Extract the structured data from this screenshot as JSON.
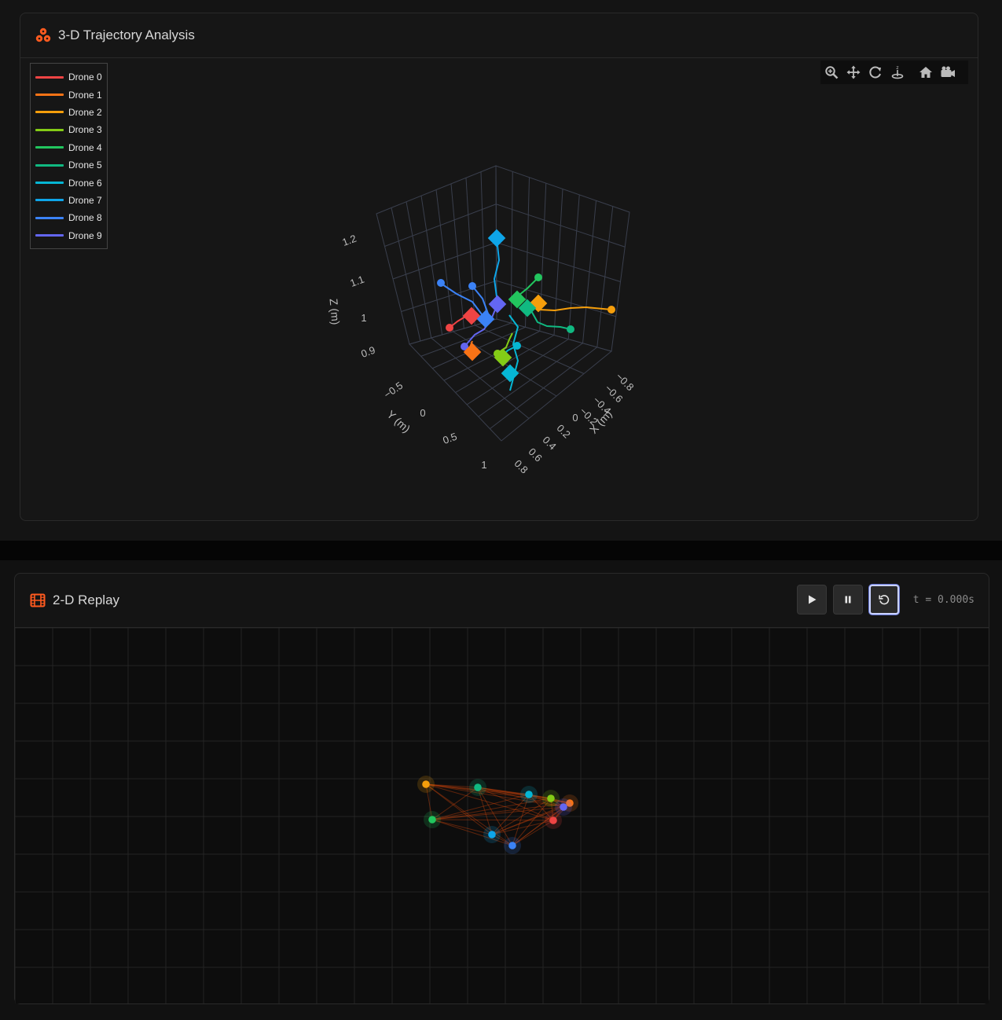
{
  "colors": {
    "accent": "#ff5a1f",
    "drones": [
      "#ef4444",
      "#f97316",
      "#f59e0b",
      "#84cc16",
      "#22c55e",
      "#10b981",
      "#06b6d4",
      "#0ea5e9",
      "#3b82f6",
      "#6366f1"
    ]
  },
  "panel3d": {
    "title": "3-D Trajectory Analysis",
    "icon": "drone-cluster-icon",
    "modebar": [
      "zoom-icon",
      "pan-icon",
      "orbit-rotate-icon",
      "turntable-rotate-icon",
      "reset-camera-home-icon",
      "camera-snapshot-icon"
    ],
    "legend": [
      "Drone 0",
      "Drone 1",
      "Drone 2",
      "Drone 3",
      "Drone 4",
      "Drone 5",
      "Drone 6",
      "Drone 7",
      "Drone 8",
      "Drone 9"
    ],
    "axes": {
      "x": {
        "title": "X (m)",
        "ticks": [
          "−0.8",
          "−0.6",
          "−0.4",
          "−0.2",
          "0",
          "0.2",
          "0.4",
          "0.6",
          "0.8"
        ]
      },
      "y": {
        "title": "Y (m)",
        "ticks": [
          "−0.5",
          "0",
          "0.5",
          "1"
        ]
      },
      "z": {
        "title": "Z (m)",
        "ticks": [
          "0.9",
          "1",
          "1.1",
          "1.2"
        ]
      }
    }
  },
  "panel2d": {
    "title": "2-D Replay",
    "icon": "film-icon",
    "controls": {
      "play": "play-icon",
      "pause": "pause-icon",
      "reset": "reset-icon"
    },
    "time_readout": "t = 0.000s"
  }
}
